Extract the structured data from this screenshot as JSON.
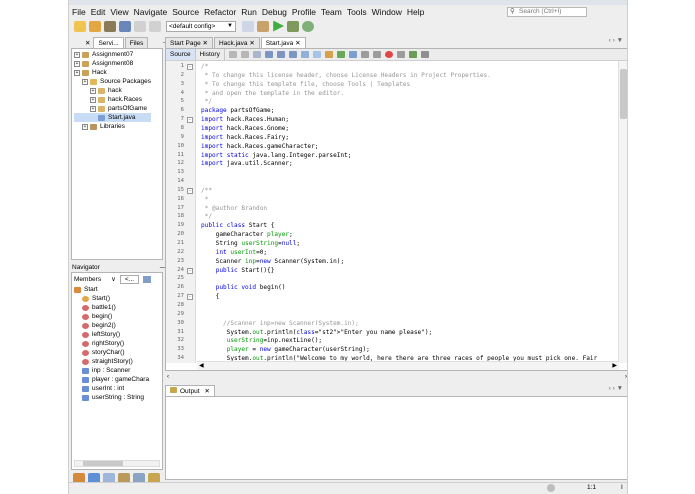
{
  "menu": [
    "File",
    "Edit",
    "View",
    "Navigate",
    "Source",
    "Refactor",
    "Run",
    "Debug",
    "Profile",
    "Team",
    "Tools",
    "Window",
    "Help"
  ],
  "search_placeholder": "Search (Ctrl+I)",
  "config_combo": "<default config>",
  "projects_tabs": [
    "Servi...",
    "Files"
  ],
  "projects_tree": [
    {
      "label": "Assignment07",
      "indent": 0,
      "icon": "project-icon"
    },
    {
      "label": "Assignment08",
      "indent": 0,
      "icon": "project-icon"
    },
    {
      "label": "Hack",
      "indent": 0,
      "icon": "project-icon"
    },
    {
      "label": "Source Packages",
      "indent": 1,
      "icon": "folder-icon"
    },
    {
      "label": "hack",
      "indent": 2,
      "icon": "package-icon"
    },
    {
      "label": "hack.Races",
      "indent": 2,
      "icon": "package-icon"
    },
    {
      "label": "partsOfGame",
      "indent": 2,
      "icon": "package-icon"
    },
    {
      "label": "Start.java",
      "indent": 3,
      "icon": "java-file-icon",
      "selected": true
    },
    {
      "label": "Libraries",
      "indent": 1,
      "icon": "library-icon"
    }
  ],
  "navigator": {
    "title": "Navigator",
    "members_label": "Members",
    "combo": "<...",
    "items": [
      {
        "label": "Start",
        "indent": 0,
        "icon": "class-icon"
      },
      {
        "label": "Start()",
        "indent": 1,
        "icon": "constructor-icon"
      },
      {
        "label": "battle1()",
        "indent": 1,
        "icon": "method-icon"
      },
      {
        "label": "begin()",
        "indent": 1,
        "icon": "method-icon"
      },
      {
        "label": "begin2()",
        "indent": 1,
        "icon": "method-icon"
      },
      {
        "label": "leftStory()",
        "indent": 1,
        "icon": "method-icon"
      },
      {
        "label": "rightStory()",
        "indent": 1,
        "icon": "method-icon"
      },
      {
        "label": "storyChar()",
        "indent": 1,
        "icon": "method-icon"
      },
      {
        "label": "straightStory()",
        "indent": 1,
        "icon": "method-icon"
      },
      {
        "label": "inp : Scanner",
        "indent": 1,
        "icon": "field-icon"
      },
      {
        "label": "player : gameChara",
        "indent": 1,
        "icon": "field-icon"
      },
      {
        "label": "userInt : int",
        "indent": 1,
        "icon": "field-icon"
      },
      {
        "label": "userString : String",
        "indent": 1,
        "icon": "field-icon"
      }
    ]
  },
  "editor_tabs": [
    "Start Page",
    "Hack.java",
    "Start.java"
  ],
  "editor_toolbar": {
    "source": "Source",
    "history": "History"
  },
  "code_lines": [
    {
      "n": "1",
      "t": "/*",
      "c": "cm",
      "fold": "-"
    },
    {
      "n": "2",
      "t": " * To change this license header, choose License Headers in Project Properties.",
      "c": "cm"
    },
    {
      "n": "3",
      "t": " * To change this template file, choose Tools | Templates",
      "c": "cm"
    },
    {
      "n": "4",
      "t": " * and open the template in the editor.",
      "c": "cm"
    },
    {
      "n": "5",
      "t": " */",
      "c": "cm"
    },
    {
      "n": "6",
      "t": "package partsOfGame;",
      "c": "pkg"
    },
    {
      "n": "7",
      "t": "import hack.Races.Human;",
      "c": "imp",
      "fold": "-"
    },
    {
      "n": "8",
      "t": "import hack.Races.Gnome;",
      "c": "imp"
    },
    {
      "n": "9",
      "t": "import hack.Races.Fairy;",
      "c": "imp"
    },
    {
      "n": "10",
      "t": "import hack.Races.gameCharacter;",
      "c": "imp"
    },
    {
      "n": "11",
      "t": "import static java.lang.Integer.parseInt;",
      "c": "imp"
    },
    {
      "n": "12",
      "t": "import java.util.Scanner;",
      "c": "imp"
    },
    {
      "n": "13",
      "t": "",
      "c": ""
    },
    {
      "n": "14",
      "t": "",
      "c": ""
    },
    {
      "n": "15",
      "t": "/**",
      "c": "cm",
      "fold": "-"
    },
    {
      "n": "16",
      "t": " *",
      "c": "cm"
    },
    {
      "n": "17",
      "t": " * @author Brandon",
      "c": "cm"
    },
    {
      "n": "18",
      "t": " */",
      "c": "cm"
    },
    {
      "n": "19",
      "t": "public class Start {",
      "c": "cls"
    },
    {
      "n": "20",
      "t": "    gameCharacter player;",
      "c": "fld1"
    },
    {
      "n": "21",
      "t": "    String userString=null;",
      "c": "fld2"
    },
    {
      "n": "22",
      "t": "    int userInt=0;",
      "c": "fld3"
    },
    {
      "n": "23",
      "t": "    Scanner inp=new Scanner(System.in);",
      "c": "fld4"
    },
    {
      "n": "24",
      "t": "    public Start(){}",
      "c": "ctor",
      "fold": "-"
    },
    {
      "n": "25",
      "t": "",
      "c": ""
    },
    {
      "n": "26",
      "t": "    public void begin()",
      "c": "meth"
    },
    {
      "n": "27",
      "t": "    {",
      "c": "",
      "fold": "-"
    },
    {
      "n": "28",
      "t": "",
      "c": ""
    },
    {
      "n": "29",
      "t": "",
      "c": ""
    },
    {
      "n": "30",
      "t": "      //Scanner inp=new Scanner(System.in);",
      "c": "cm"
    },
    {
      "n": "31",
      "t": "       System.out.println(\"Enter you name please\");",
      "c": "print"
    },
    {
      "n": "32",
      "t": "       userString=inp.nextLine();",
      "c": "asg1"
    },
    {
      "n": "33",
      "t": "       player = new gameCharacter(userString);",
      "c": "asg2"
    },
    {
      "n": "34",
      "t": "       System.out.println(\"Welcome to my world, here there are three races of people you must pick one. Fair",
      "c": "print"
    }
  ],
  "output_tab": "Output",
  "status": {
    "cursor": "1:1",
    "ins": "I"
  }
}
